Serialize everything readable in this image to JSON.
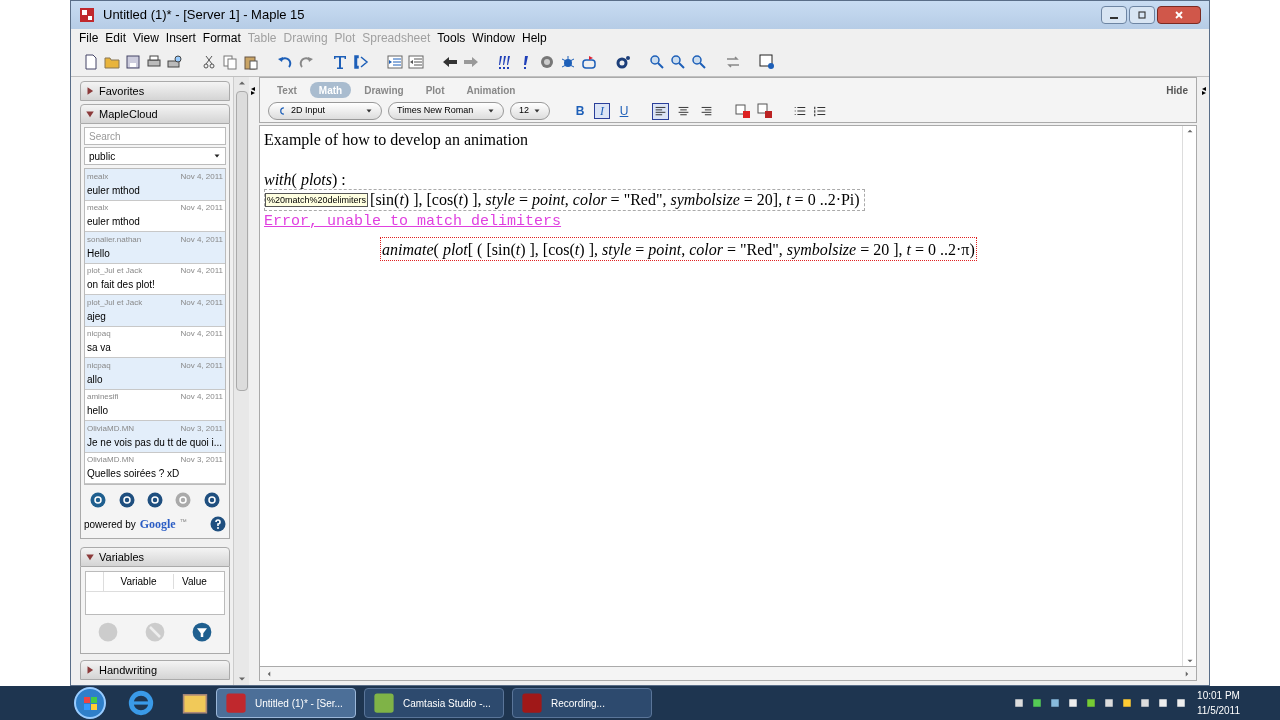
{
  "window": {
    "title": "Untitled (1)* - [Server 1] - Maple 15"
  },
  "menu": [
    {
      "label": "File",
      "disabled": false
    },
    {
      "label": "Edit",
      "disabled": false
    },
    {
      "label": "View",
      "disabled": false
    },
    {
      "label": "Insert",
      "disabled": false
    },
    {
      "label": "Format",
      "disabled": false
    },
    {
      "label": "Table",
      "disabled": true
    },
    {
      "label": "Drawing",
      "disabled": true
    },
    {
      "label": "Plot",
      "disabled": true
    },
    {
      "label": "Spreadsheet",
      "disabled": true
    },
    {
      "label": "Tools",
      "disabled": false
    },
    {
      "label": "Window",
      "disabled": false
    },
    {
      "label": "Help",
      "disabled": false
    }
  ],
  "sidebar": {
    "favorites": {
      "title": "Favorites",
      "expanded": false
    },
    "maplecloud": {
      "title": "MapleCloud",
      "expanded": true,
      "search": {
        "placeholder": "Search"
      },
      "group": "public",
      "items": [
        {
          "user": "mealx",
          "date": "Nov 4, 2011",
          "title": "euler mthod"
        },
        {
          "user": "mealx",
          "date": "Nov 4, 2011",
          "title": "euler mthod"
        },
        {
          "user": "sonalier.nathan",
          "date": "Nov 4, 2011",
          "title": "Hello"
        },
        {
          "user": "plot_Jul et Jack",
          "date": "Nov 4, 2011",
          "title": "on fait des plot!"
        },
        {
          "user": "plot_Jul et Jack",
          "date": "Nov 4, 2011",
          "title": "ajeg"
        },
        {
          "user": "nicpaq",
          "date": "Nov 4, 2011",
          "title": "sa va"
        },
        {
          "user": "nicpaq",
          "date": "Nov 4, 2011",
          "title": "allo"
        },
        {
          "user": "aminesifi",
          "date": "Nov 4, 2011",
          "title": "hello"
        },
        {
          "user": "OliviaMD.MN",
          "date": "Nov 3, 2011",
          "title": "Je ne vois pas du tt de quoi i..."
        },
        {
          "user": "OliviaMD.MN",
          "date": "Nov 3, 2011",
          "title": "Quelles soirées ? xD"
        }
      ],
      "powered_by": "powered by",
      "google": "Google",
      "google_tm": "™"
    },
    "variables": {
      "title": "Variables",
      "expanded": true,
      "columns": [
        "Variable",
        "Value"
      ]
    },
    "handwriting": {
      "title": "Handwriting",
      "expanded": false
    }
  },
  "context_bar": {
    "tabs": [
      {
        "label": "Text",
        "selected": false
      },
      {
        "label": "Math",
        "selected": true
      },
      {
        "label": "Drawing",
        "selected": false
      },
      {
        "label": "Plot",
        "selected": false
      },
      {
        "label": "Animation",
        "selected": false
      }
    ],
    "hide": "Hide",
    "input_mode": "2D Input",
    "font": "Times New Roman",
    "size": "12",
    "style_buttons": [
      {
        "label": "B",
        "selected": false
      },
      {
        "label": "I",
        "selected": true
      },
      {
        "label": "U",
        "selected": false
      }
    ],
    "alignment": [
      {
        "kind": "left",
        "selected": true
      },
      {
        "kind": "center",
        "selected": false
      },
      {
        "kind": "right",
        "selected": false
      }
    ]
  },
  "document": {
    "heading": "Example of how to develop an animation",
    "lines": [
      {
        "kind": "input",
        "text": "*with*( *plots*) :"
      },
      {
        "kind": "input_box",
        "tooltip": "%20match%20delimiters",
        "text": "[sin(*t*) ], [cos(*t*) ], *style* = *point*, *color* = \"Red\", *symbolsize* = 20], *t* = 0 ..2·Pi)"
      },
      {
        "kind": "error",
        "text": "Error, unable to match delimiters"
      },
      {
        "kind": "suggestion",
        "text": "*animate*( *plot*[ ( [sin(*t*) ], [cos(*t*) ], *style* = *point*, *color* = \"Red\", *symbolsize* = 20 ], *t* = 0 ..2·π)"
      }
    ]
  },
  "taskbar": {
    "tasks": [
      {
        "label": "Untitled (1)* - [Ser...",
        "selected": true
      },
      {
        "label": "Camtasia Studio -...",
        "selected": false
      },
      {
        "label": "Recording...",
        "selected": false
      }
    ],
    "time": "10:01 PM",
    "date": "11/5/2011"
  }
}
